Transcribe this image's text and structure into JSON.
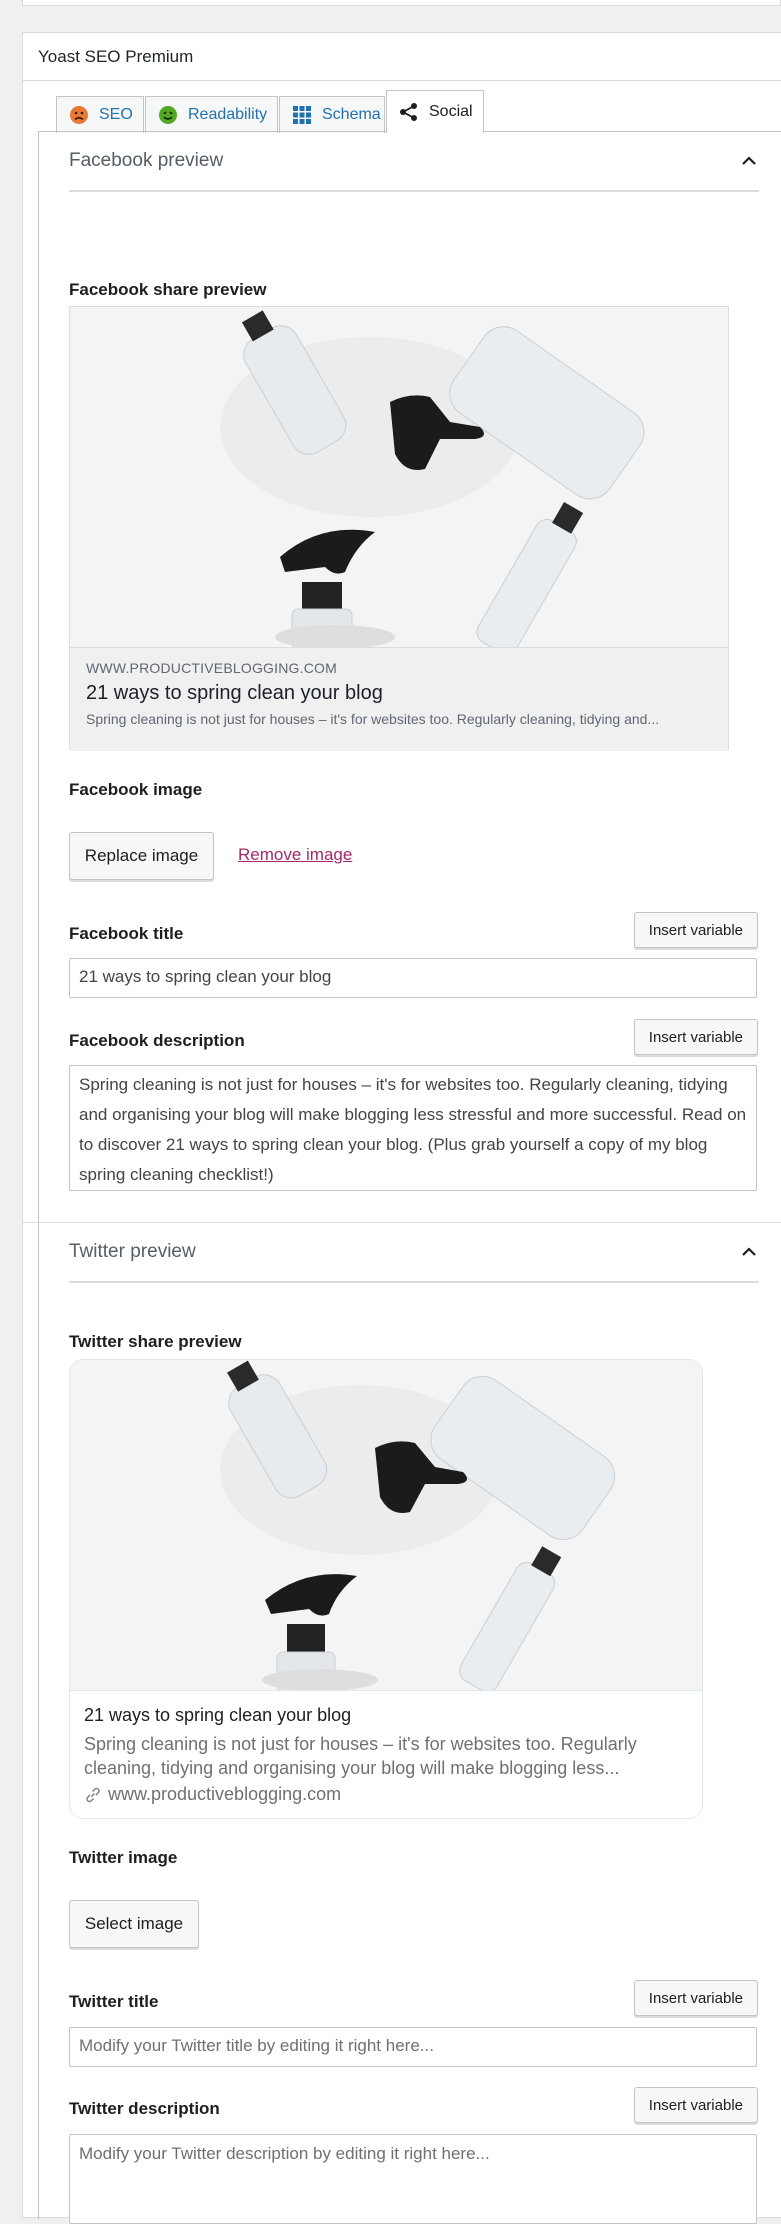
{
  "metabox": {
    "title": "Yoast SEO Premium"
  },
  "tabs": [
    {
      "label": "SEO",
      "icon": "sad-face-icon",
      "active": false
    },
    {
      "label": "Readability",
      "icon": "smiley-face-icon",
      "active": false
    },
    {
      "label": "Schema",
      "icon": "grid-icon",
      "active": false
    },
    {
      "label": "Social",
      "icon": "share-icon",
      "active": true
    }
  ],
  "facebook": {
    "section_title": "Facebook preview",
    "share_preview_label": "Facebook share preview",
    "card": {
      "domain": "WWW.PRODUCTIVEBLOGGING.COM",
      "title": "21 ways to spring clean your blog",
      "description": "Spring cleaning is not just for houses – it's for websites too. Regularly cleaning, tidying and..."
    },
    "image_label": "Facebook image",
    "replace_image": "Replace image",
    "remove_image": "Remove image",
    "title_label": "Facebook title",
    "title_value": "21 ways to spring clean your blog",
    "description_label": "Facebook description",
    "description_value": "Spring cleaning is not just for houses – it's for websites too. Regularly cleaning, tidying and organising your blog will make blogging less stressful and more successful. Read on to discover 21 ways to spring clean your blog. (Plus grab yourself a copy of my blog spring cleaning checklist!)",
    "insert_variable": "Insert variable"
  },
  "twitter": {
    "section_title": "Twitter preview",
    "share_preview_label": "Twitter share preview",
    "card": {
      "title": "21 ways to spring clean your blog",
      "description": "Spring cleaning is not just for houses – it's for websites too. Regularly cleaning, tidying and organising your blog will make blogging less...",
      "domain": "www.productiveblogging.com"
    },
    "image_label": "Twitter image",
    "select_image": "Select image",
    "title_label": "Twitter title",
    "title_placeholder": "Modify your Twitter title by editing it right here...",
    "description_label": "Twitter description",
    "description_placeholder": "Modify your Twitter description by editing it right here...",
    "insert_variable": "Insert variable"
  },
  "colors": {
    "link_blue": "#2271b1",
    "remove_link": "#a4286a",
    "seo_bad": "#dc3232",
    "readability_good": "#7ad03a"
  }
}
